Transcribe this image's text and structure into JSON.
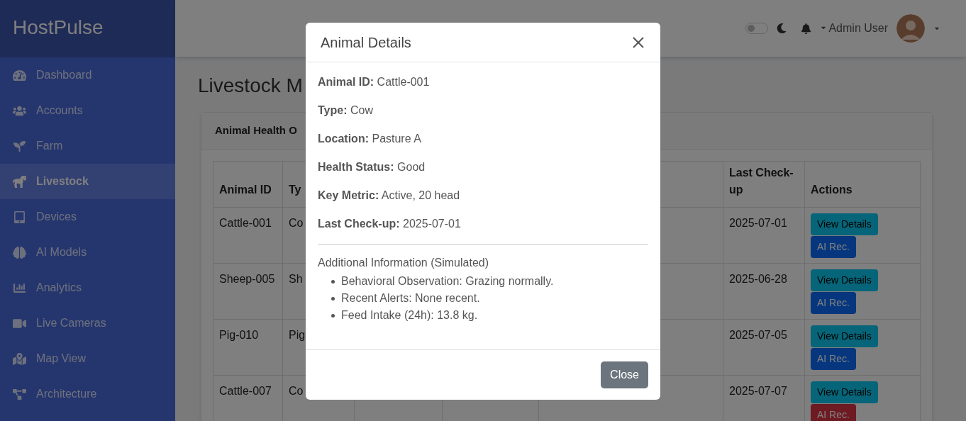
{
  "sidebar": {
    "brand": "HostPulse",
    "items": [
      {
        "label": "Dashboard",
        "selected": false
      },
      {
        "label": "Accounts",
        "selected": false
      },
      {
        "label": "Farm",
        "selected": false
      },
      {
        "label": "Livestock",
        "selected": true
      },
      {
        "label": "Devices",
        "selected": false
      },
      {
        "label": "AI Models",
        "selected": false
      },
      {
        "label": "Analytics",
        "selected": false
      },
      {
        "label": "Live Cameras",
        "selected": false
      },
      {
        "label": "Map View",
        "selected": false
      },
      {
        "label": "Architecture",
        "selected": false
      }
    ]
  },
  "topbar": {
    "dark_mode": {
      "on": false
    },
    "user": "Admin User"
  },
  "page_title": "Livestock M",
  "card": {
    "title": "Animal Health O",
    "table": {
      "columns": [
        "Animal ID",
        "Ty",
        "Last Check-up",
        "Actions"
      ],
      "rows": [
        {
          "animal_id": "Cattle-001",
          "type": "Co",
          "last_checkup": "2025-07-01",
          "actions": [
            {
              "label": "View Details",
              "kind": "info"
            },
            {
              "label": "AI Rec.",
              "kind": "primary"
            }
          ]
        },
        {
          "animal_id": "Sheep-005",
          "type": "Sh",
          "last_checkup": "2025-06-28",
          "actions": [
            {
              "label": "View Details",
              "kind": "info"
            },
            {
              "label": "AI Rec.",
              "kind": "primary"
            }
          ]
        },
        {
          "animal_id": "Pig-010",
          "type": "Pig",
          "last_checkup": "2025-07-05",
          "actions": [
            {
              "label": "View Details",
              "kind": "info"
            },
            {
              "label": "AI Rec.",
              "kind": "primary"
            }
          ]
        },
        {
          "animal_id": "Cattle-007",
          "type": "Co",
          "last_checkup": "2025-07-07",
          "actions": [
            {
              "label": "View Details",
              "kind": "info"
            },
            {
              "label": "AI Rec.",
              "kind": "danger"
            }
          ]
        }
      ]
    }
  },
  "modal": {
    "title": "Animal Details",
    "fields": [
      {
        "label": "Animal ID:",
        "value": "Cattle-001"
      },
      {
        "label": "Type:",
        "value": "Cow"
      },
      {
        "label": "Location:",
        "value": "Pasture A"
      },
      {
        "label": "Health Status:",
        "value": "Good"
      },
      {
        "label": "Key Metric:",
        "value": "Active, 20 head"
      },
      {
        "label": "Last Check-up:",
        "value": "2025-07-01"
      }
    ],
    "section_title": "Additional Information (Simulated)",
    "bullets": [
      "Behavioral Observation: Grazing normally.",
      "Recent Alerts: None recent.",
      "Feed Intake (24h): 13.8 kg."
    ],
    "close_button": "Close"
  }
}
